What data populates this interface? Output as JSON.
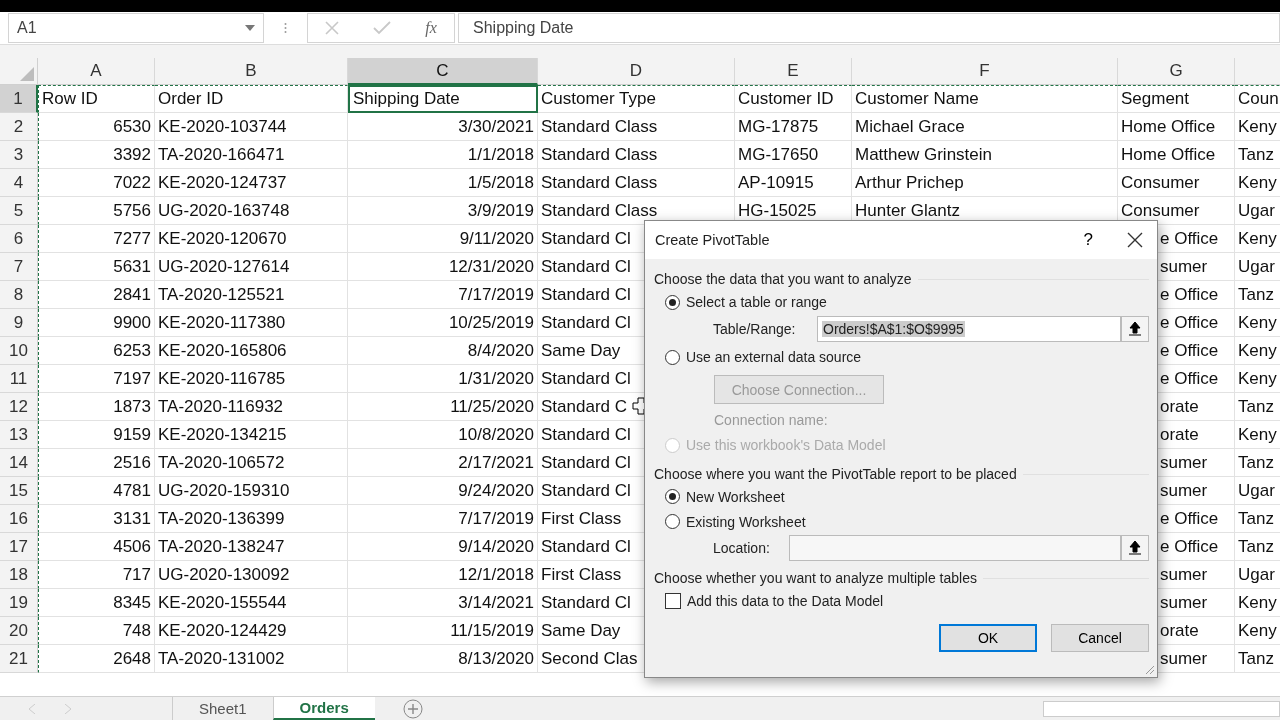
{
  "name_box": {
    "value": "A1"
  },
  "formula_bar": {
    "function_label": "fx",
    "value": "Shipping Date"
  },
  "columns": [
    {
      "label": "A",
      "kind": "number",
      "selected": false
    },
    {
      "label": "B",
      "kind": "text",
      "selected": false
    },
    {
      "label": "C",
      "kind": "number",
      "selected": true
    },
    {
      "label": "D",
      "kind": "text",
      "selected": false
    },
    {
      "label": "E",
      "kind": "text",
      "selected": false
    },
    {
      "label": "F",
      "kind": "text",
      "selected": false
    },
    {
      "label": "G",
      "kind": "text",
      "selected": false
    },
    {
      "kind": "text",
      "selected": false
    }
  ],
  "rows": [
    {
      "number": "1",
      "selected": true,
      "partly_hidden": false,
      "cells": [
        "Row ID",
        "Order ID",
        "Shipping Date",
        "Customer Type",
        "Customer ID",
        "Customer Name",
        "Segment",
        "Coun"
      ]
    },
    {
      "number": "2",
      "selected": false,
      "partly_hidden": false,
      "cells": [
        "6530",
        "KE-2020-103744",
        "3/30/2021",
        "Standard Class",
        "MG-17875",
        "Michael Grace",
        "Home Office",
        "Keny"
      ]
    },
    {
      "number": "3",
      "selected": false,
      "partly_hidden": false,
      "cells": [
        "3392",
        "TA-2020-166471",
        "1/1/2018",
        "Standard Class",
        "MG-17650",
        "Matthew Grinstein",
        "Home Office",
        "Tanz"
      ]
    },
    {
      "number": "4",
      "selected": false,
      "partly_hidden": false,
      "cells": [
        "7022",
        "KE-2020-124737",
        "1/5/2018",
        "Standard Class",
        "AP-10915",
        "Arthur Prichep",
        "Consumer",
        "Keny"
      ]
    },
    {
      "number": "5",
      "selected": false,
      "partly_hidden": false,
      "cells": [
        "5756",
        "UG-2020-163748",
        "3/9/2019",
        "Standard Class",
        "HG-15025",
        "Hunter Glantz",
        "Consumer",
        "Ugar"
      ]
    },
    {
      "number": "6",
      "selected": false,
      "partly_hidden": true,
      "cells": [
        "7277",
        "KE-2020-120670",
        "9/11/2020",
        "Standard Cl",
        null,
        null,
        "e Office",
        "Keny"
      ]
    },
    {
      "number": "7",
      "selected": false,
      "partly_hidden": true,
      "cells": [
        "5631",
        "UG-2020-127614",
        "12/31/2020",
        "Standard Cl",
        null,
        null,
        "sumer",
        "Ugar"
      ]
    },
    {
      "number": "8",
      "selected": false,
      "partly_hidden": true,
      "cells": [
        "2841",
        "TA-2020-125521",
        "7/17/2019",
        "Standard Cl",
        null,
        null,
        "e Office",
        "Tanz"
      ]
    },
    {
      "number": "9",
      "selected": false,
      "partly_hidden": true,
      "cells": [
        "9900",
        "KE-2020-117380",
        "10/25/2019",
        "Standard Cl",
        null,
        null,
        "e Office",
        "Keny"
      ]
    },
    {
      "number": "10",
      "selected": false,
      "partly_hidden": true,
      "cells": [
        "6253",
        "KE-2020-165806",
        "8/4/2020",
        "Same Day",
        null,
        null,
        "e Office",
        "Keny"
      ]
    },
    {
      "number": "11",
      "selected": false,
      "partly_hidden": true,
      "cells": [
        "7197",
        "KE-2020-116785",
        "1/31/2020",
        "Standard Cl",
        null,
        null,
        "e Office",
        "Keny"
      ]
    },
    {
      "number": "12",
      "selected": false,
      "partly_hidden": true,
      "cells": [
        "1873",
        "TA-2020-116932",
        "11/25/2020",
        "Standard C",
        null,
        null,
        "orate",
        "Tanz"
      ]
    },
    {
      "number": "13",
      "selected": false,
      "partly_hidden": true,
      "cells": [
        "9159",
        "KE-2020-134215",
        "10/8/2020",
        "Standard Cl",
        null,
        null,
        "orate",
        "Keny"
      ]
    },
    {
      "number": "14",
      "selected": false,
      "partly_hidden": true,
      "cells": [
        "2516",
        "TA-2020-106572",
        "2/17/2021",
        "Standard Cl",
        null,
        null,
        "sumer",
        "Tanz"
      ]
    },
    {
      "number": "15",
      "selected": false,
      "partly_hidden": true,
      "cells": [
        "4781",
        "UG-2020-159310",
        "9/24/2020",
        "Standard Cl",
        null,
        null,
        "sumer",
        "Ugar"
      ]
    },
    {
      "number": "16",
      "selected": false,
      "partly_hidden": true,
      "cells": [
        "3131",
        "TA-2020-136399",
        "7/17/2019",
        "First Class",
        null,
        null,
        "e Office",
        "Tanz"
      ]
    },
    {
      "number": "17",
      "selected": false,
      "partly_hidden": true,
      "cells": [
        "4506",
        "TA-2020-138247",
        "9/14/2020",
        "Standard Cl",
        null,
        null,
        "e Office",
        "Tanz"
      ]
    },
    {
      "number": "18",
      "selected": false,
      "partly_hidden": true,
      "cells": [
        "717",
        "UG-2020-130092",
        "12/1/2018",
        "First Class",
        null,
        null,
        "sumer",
        "Ugar"
      ]
    },
    {
      "number": "19",
      "selected": false,
      "partly_hidden": true,
      "cells": [
        "8345",
        "KE-2020-155544",
        "3/14/2021",
        "Standard Cl",
        null,
        null,
        "sumer",
        "Keny"
      ]
    },
    {
      "number": "20",
      "selected": false,
      "partly_hidden": true,
      "cells": [
        "748",
        "KE-2020-124429",
        "11/15/2019",
        "Same Day",
        null,
        null,
        "orate",
        "Keny"
      ]
    },
    {
      "number": "21",
      "selected": false,
      "partly_hidden": true,
      "cells": [
        "2648",
        "TA-2020-131002",
        "8/13/2020",
        "Second Clas",
        null,
        null,
        "sumer",
        "Tanz"
      ]
    }
  ],
  "dialog": {
    "title": "Create PivotTable",
    "help": "?",
    "data_heading": "Choose the data that you want to analyze",
    "data_options": [
      {
        "label": "Select a table or range",
        "selected": true,
        "disabled": false
      },
      {
        "label": "Use an external data source",
        "selected": false,
        "disabled": false
      }
    ],
    "range_label": "Table/Range:",
    "range_value": "Orders!$A$1:$O$9995",
    "connection_button": {
      "label": "Choose Connection...",
      "disabled": true
    },
    "connection_name_label": "Connection name:",
    "data_model_option": {
      "label": "Use this workbook's Data Model",
      "selected": false,
      "disabled": true
    },
    "placement_heading": "Choose where you want the PivotTable report to be placed",
    "placement_options": [
      {
        "label": "New Worksheet",
        "selected": true,
        "disabled": false
      },
      {
        "label": "Existing Worksheet",
        "selected": false,
        "disabled": false
      }
    ],
    "location_label": "Location:",
    "tables_heading": "Choose whether you want to analyze multiple tables",
    "data_model_checkbox": {
      "label": "Add this data to the Data Model",
      "checked": false
    },
    "buttons": [
      {
        "label": "OK",
        "kind": "default"
      },
      {
        "label": "Cancel",
        "kind": "normal"
      }
    ]
  },
  "sheet_tabs": [
    {
      "label": "Sheet1",
      "selected": false
    },
    {
      "label": "Orders",
      "selected": true
    }
  ]
}
